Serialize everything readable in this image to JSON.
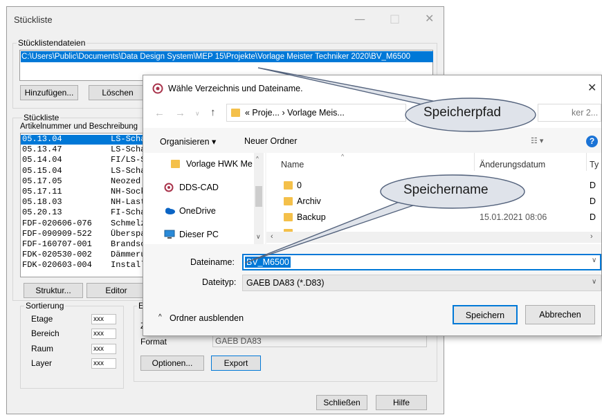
{
  "window": {
    "title": "Stückliste",
    "minimize": "—",
    "maximize": "□",
    "close": "✕"
  },
  "files_group": {
    "label": "Stücklistendateien",
    "path": "C:\\Users\\Public\\Documents\\Data Design System\\MEP 15\\Projekte\\Vorlage Meister Techniker 2020\\BV_M6500",
    "add_label": "Hinzufügen...",
    "delete_label": "Löschen"
  },
  "list_group": {
    "label": "Stückliste",
    "column_header": "Artikelnummer und  Beschreibung",
    "rows": [
      {
        "num": "05.13.04",
        "desc": "LS-Scha"
      },
      {
        "num": "05.13.47",
        "desc": "LS-Scha"
      },
      {
        "num": "05.14.04",
        "desc": "FI/LS-S"
      },
      {
        "num": "05.15.04",
        "desc": "LS-Scha"
      },
      {
        "num": "05.17.05",
        "desc": "Neozed"
      },
      {
        "num": "05.17.11",
        "desc": "NH-Sock"
      },
      {
        "num": "05.18.03",
        "desc": "NH-Last"
      },
      {
        "num": "05.20.13",
        "desc": "FI-Scha"
      },
      {
        "num": "FDF-020606-076",
        "desc": "Schmelz"
      },
      {
        "num": "FDF-090909-522",
        "desc": "Überspa"
      },
      {
        "num": "FDF-160707-001",
        "desc": "Brandsc"
      },
      {
        "num": "FDK-020530-002",
        "desc": "Dämmeru"
      },
      {
        "num": "FDK-020603-004",
        "desc": "Install"
      }
    ],
    "structure_label": "Struktur...",
    "editor_label": "Editor"
  },
  "sort_group": {
    "label": "Sortierung",
    "rows": [
      {
        "label": "Etage",
        "value": "xxx"
      },
      {
        "label": "Bereich",
        "value": "xxx"
      },
      {
        "label": "Raum",
        "value": "xxx"
      },
      {
        "label": "Layer",
        "value": "xxx"
      }
    ]
  },
  "export_group": {
    "label_partial": "Ex",
    "z_partial": "Z",
    "format_label": "Format",
    "format_value": "GAEB DA83",
    "options_label": "Optionen...",
    "export_label": "Export"
  },
  "footer": {
    "close_label": "Schließen",
    "help_label": "Hilfe"
  },
  "dialog": {
    "title": "Wähle Verzeichnis und Dateiname.",
    "close": "✕",
    "breadcrumb": "«  Proje...  ›  Vorlage Meis...",
    "search_partial": "ker 2...",
    "organize_label": "Organisieren ▾",
    "new_folder_label": "Neuer Ordner",
    "nav_items": [
      "Vorlage HWK Me",
      "DDS-CAD",
      "OneDrive",
      "Dieser PC"
    ],
    "columns": {
      "name": "Name",
      "date": "Änderungsdatum",
      "type": "Ty"
    },
    "files": [
      {
        "name": "0",
        "date": "",
        "type": "D"
      },
      {
        "name": "Archiv",
        "date": "",
        "type": "D"
      },
      {
        "name": "Backup",
        "date": "15.01.2021 08:06",
        "type": "D"
      },
      {
        "name": "",
        "date": "",
        "type": ""
      }
    ],
    "filename_label": "Dateiname:",
    "filename_value": "BV_M6500",
    "filetype_label": "Dateityp:",
    "filetype_value": "GAEB DA83 (*.D83)",
    "hide_folders_label": "Ordner ausblenden",
    "save_label": "Speichern",
    "cancel_label": "Abbrechen"
  },
  "callouts": {
    "path": "Speicherpfad",
    "name": "Speichername"
  }
}
